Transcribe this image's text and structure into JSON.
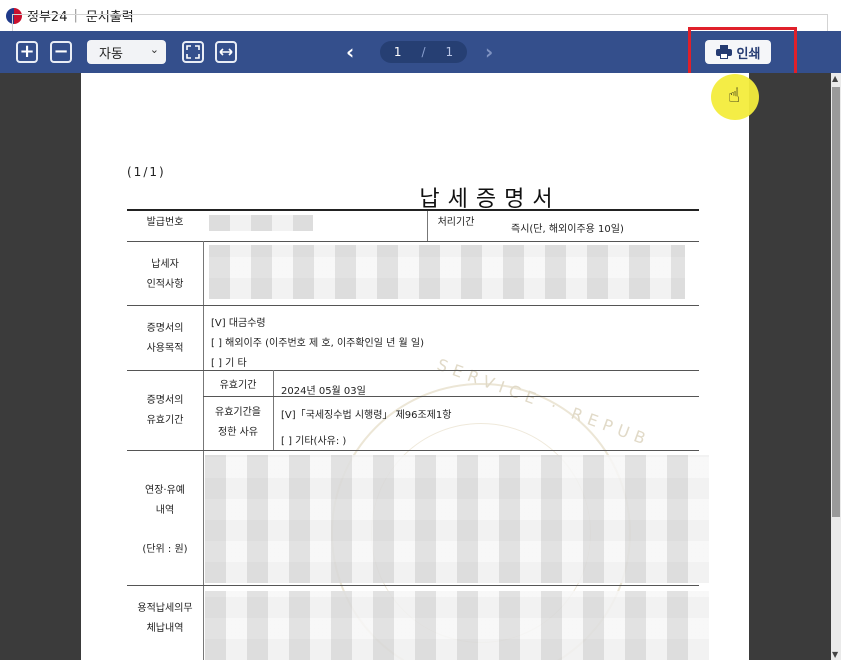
{
  "window": {
    "app_name": "정부24",
    "separator": "|",
    "title": "문서출력"
  },
  "toolbar": {
    "zoom_in_icon": "+",
    "zoom_out_icon": "−",
    "zoom_value": "자동",
    "current_page": "1",
    "page_separator": "/",
    "total_pages": "1",
    "print_label": "인쇄",
    "prev_icon": "‹",
    "next_icon": "›"
  },
  "document": {
    "page_count": "(1/1)",
    "title": "납세증명서",
    "rows": {
      "issue_no_label": "발급번호",
      "processing_label": "처리기간",
      "processing_value": "즉시(단, 해외이주용 10일)",
      "taxpayer_label_1": "납세자",
      "taxpayer_label_2": "인적사항",
      "purpose_label_1": "증명서의",
      "purpose_label_2": "사용목적",
      "purpose_opt_1": "[V] 대금수령",
      "purpose_opt_2": "[ ] 해외이주  (이주번호 제                     호, 이주확인일          년      월      일)",
      "purpose_opt_3": "[ ] 기      타",
      "validity_label_1": "증명서의",
      "validity_label_2": "유효기간",
      "validity_period_label": "유효기간",
      "validity_period_value": "2024년 05월 03일",
      "validity_reason_label_1": "유효기간을",
      "validity_reason_label_2": "정한 사유",
      "validity_reason_opt_1": "[V]「국세징수법 시행령」 제96조제1항",
      "validity_reason_opt_2": "[  ] 기타(사유:                              )",
      "deferral_label_1": "연장·유예",
      "deferral_label_2": "내역",
      "deferral_unit": "(단위 : 원)",
      "arrears_label_1": "용적납세의무",
      "arrears_label_2": "체납내역"
    }
  },
  "colors": {
    "toolbar_bg": "#344f8c",
    "viewer_bg": "#3b3b3b",
    "highlight": "#e0202a",
    "cursor_glow": "#f3ec3c"
  }
}
